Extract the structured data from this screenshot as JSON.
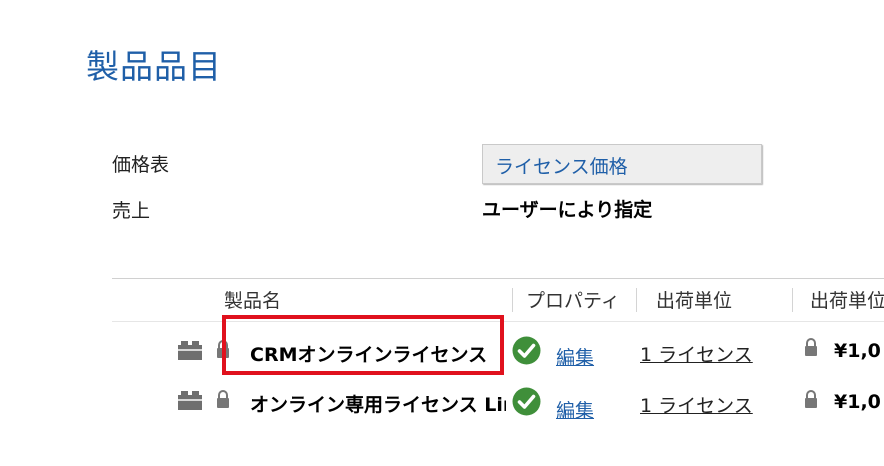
{
  "page": {
    "title": "製品品目"
  },
  "form": {
    "price_list_label": "価格表",
    "price_list_value": "ライセンス価格",
    "sales_label": "売上",
    "sales_value": "ユーザーにより指定"
  },
  "grid": {
    "columns": [
      "製品名",
      "プロパティ",
      "出荷単位",
      "出荷単位"
    ],
    "rows": [
      {
        "product_name": "CRMオンラインライセンス",
        "property_link": "編集",
        "unit": "1 ライセンス",
        "price": "¥1,0"
      },
      {
        "product_name": "オンライン専用ライセンス Lin",
        "property_link": "編集",
        "unit": "1 ライセンス",
        "price": "¥1,0"
      }
    ]
  },
  "colors": {
    "accent_blue": "#1f5fa8",
    "highlight_red": "#e0111d",
    "check_green": "#3f8f3a"
  },
  "icons": {
    "product": "product-box-icon",
    "lock": "lock-icon",
    "property_status": "check-circle-icon"
  }
}
